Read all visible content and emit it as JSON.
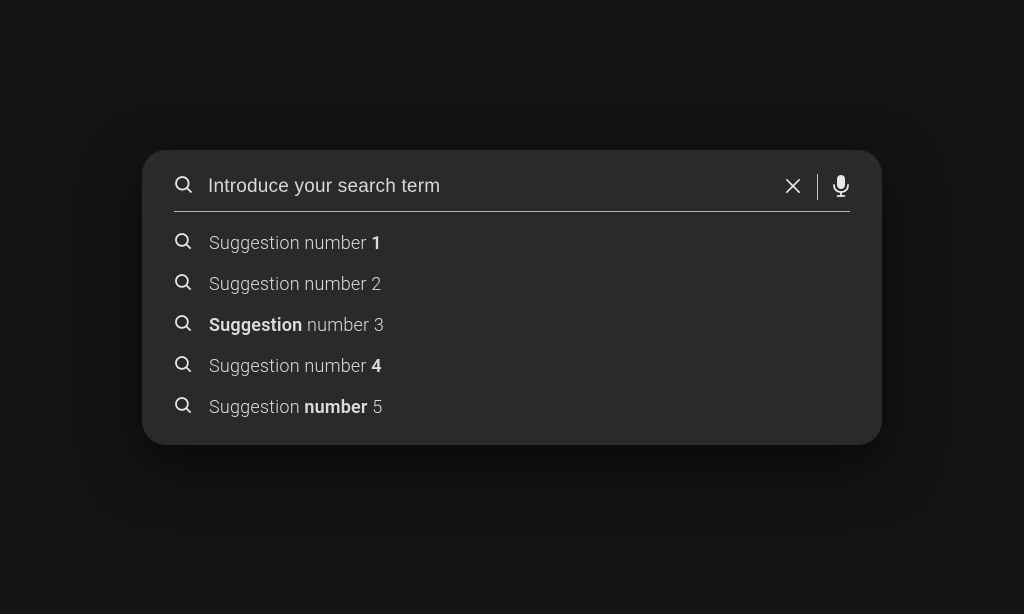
{
  "search": {
    "placeholder": "Introduce your search term",
    "value": ""
  },
  "suggestions": [
    {
      "parts": [
        {
          "text": "Suggestion number ",
          "bold": false
        },
        {
          "text": "1",
          "bold": true
        }
      ]
    },
    {
      "parts": [
        {
          "text": "Suggestion number 2",
          "bold": false
        }
      ]
    },
    {
      "parts": [
        {
          "text": "Suggestion",
          "bold": true
        },
        {
          "text": " number 3",
          "bold": false
        }
      ]
    },
    {
      "parts": [
        {
          "text": "Suggestion number ",
          "bold": false
        },
        {
          "text": "4",
          "bold": true
        }
      ]
    },
    {
      "parts": [
        {
          "text": "Suggestion ",
          "bold": false
        },
        {
          "text": "number",
          "bold": true
        },
        {
          "text": " 5",
          "bold": false
        }
      ]
    }
  ],
  "colors": {
    "background": "#141414",
    "panel": "#2a2a2a",
    "text": "#dcdcdc",
    "iconStroke": "#e8e8e8"
  }
}
